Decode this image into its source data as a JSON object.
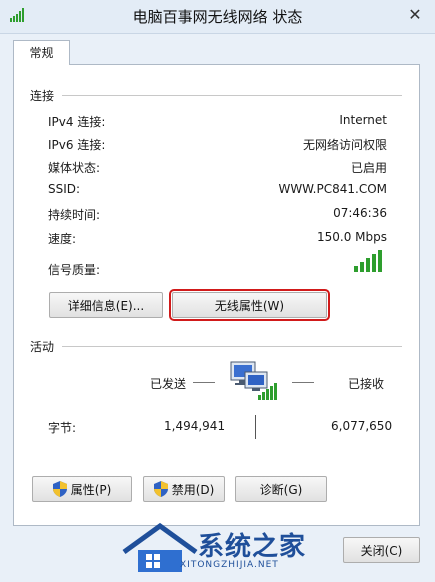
{
  "window": {
    "title": "电脑百事网无线网络 状态",
    "close_glyph": "✕"
  },
  "tabs": [
    {
      "label": "常规"
    }
  ],
  "connection": {
    "section_label": "连接",
    "rows": [
      {
        "label": "IPv4 连接:",
        "value": "Internet"
      },
      {
        "label": "IPv6 连接:",
        "value": "无网络访问权限"
      },
      {
        "label": "媒体状态:",
        "value": "已启用"
      },
      {
        "label": "SSID:",
        "value": "WWW.PC841.COM"
      },
      {
        "label": "持续时间:",
        "value": "07:46:36"
      },
      {
        "label": "速度:",
        "value": "150.0 Mbps"
      }
    ],
    "signal_label": "信号质量:",
    "signal_bars_filled": 5,
    "signal_bars_total": 5,
    "details_button": "详细信息(E)...",
    "wireless_props_button": "无线属性(W)"
  },
  "activity": {
    "section_label": "活动",
    "sent_label": "已发送",
    "received_label": "已接收",
    "bytes_label": "字节:",
    "bytes_sent": "1,494,941",
    "bytes_received": "6,077,650"
  },
  "actions": {
    "properties_button": "属性(P)",
    "disable_button": "禁用(D)",
    "diagnose_button": "诊断(G)"
  },
  "footer": {
    "close_button": "关闭(C)"
  },
  "watermark": {
    "title": "系统之家",
    "subtitle": "XITONGZHIJIA.NET"
  },
  "colors": {
    "signal_green": "#2e9e2e",
    "highlight_red": "#d11a1a",
    "watermark_blue": "#1f4f9a"
  }
}
